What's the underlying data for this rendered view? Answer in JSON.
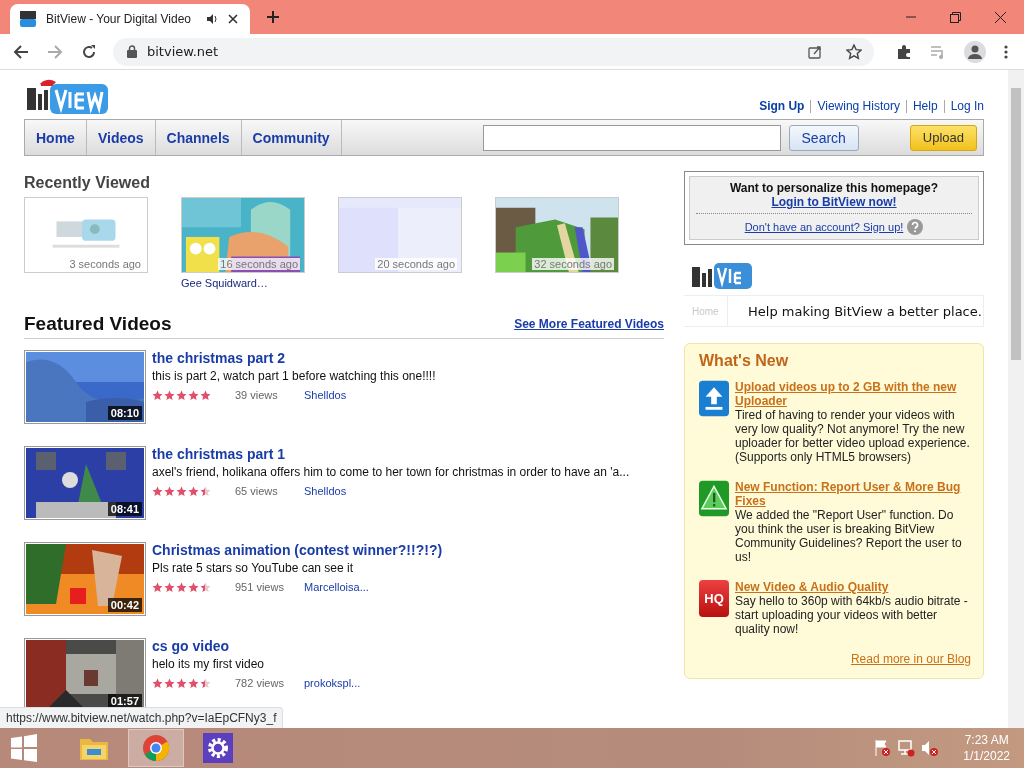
{
  "browser": {
    "tab_title": "BitView - Your Digital Video",
    "url": "bitview.net"
  },
  "header": {
    "links": [
      "Sign Up",
      "Viewing History",
      "Help",
      "Log In"
    ]
  },
  "nav": {
    "tabs": [
      {
        "label": "Home"
      },
      {
        "label": "Videos"
      },
      {
        "label": "Channels"
      },
      {
        "label": "Community"
      }
    ],
    "search_button": "Search",
    "upload_button": "Upload"
  },
  "recently_viewed": {
    "title": "Recently Viewed",
    "items": [
      {
        "time": "3 seconds ago"
      },
      {
        "time": "16 seconds ago",
        "caption": "Gee Squidward…"
      },
      {
        "time": "20 seconds ago"
      },
      {
        "time": "32 seconds ago"
      }
    ]
  },
  "featured": {
    "title": "Featured Videos",
    "more_link": "See More Featured Videos",
    "videos": [
      {
        "title": "the christmas part 2",
        "description": "this is part 2, watch part 1 before watching this one!!!!",
        "stars": 5,
        "views": "39 views",
        "author": "Shelldos",
        "duration": "08:10"
      },
      {
        "title": "the christmas part 1",
        "description": "axel's friend, holikana offers him to come to her town for christmas in order to have an 'a...",
        "stars": 4.5,
        "views": "65 views",
        "author": "Shelldos",
        "duration": "08:41"
      },
      {
        "title": "Christmas animation (contest winner?!!?!?)",
        "description": "Pls rate 5 stars so YouTube can see it",
        "stars": 4.5,
        "views": "951 views",
        "author": "Marcelloisa...",
        "duration": "00:42"
      },
      {
        "title": "cs go video",
        "description": "helo its my first video",
        "stars": 4.5,
        "views": "782 views",
        "author": "prokokspl...",
        "duration": "01:57"
      }
    ]
  },
  "login_box": {
    "question": "Want to personalize this homepage?",
    "login_link": "Login to BitView now!",
    "signup_link": "Don't have an account? Sign up!"
  },
  "banner": {
    "tab": "Home",
    "caption": "Help making BitView a better place."
  },
  "whats_new": {
    "title": "What's New",
    "items": [
      {
        "kind": "upload",
        "headline": "Upload videos up to 2 GB with the new Uploader",
        "text": "Tired of having to render your videos with very low quality? Not anymore! Try the new uploader for better video upload experience. (Supports only HTML5 browsers)"
      },
      {
        "kind": "warning",
        "headline": "New Function: Report User & More Bug Fixes",
        "text": "We added the \"Report User\" function. Do you think the user is breaking BitView Community Guidelines? Report the user to us!"
      },
      {
        "kind": "hq",
        "badge": "HQ",
        "headline": "New Video & Audio Quality",
        "text": "Say hello to 360p with 64kb/s audio bitrate - start uploading your videos with better quality now!"
      }
    ],
    "more_link": "Read more in our Blog"
  },
  "status_url": "https://www.bitview.net/watch.php?v=IaEpCFNy3_f",
  "taskbar": {
    "time": "7:23 AM",
    "date": "1/1/2022"
  }
}
